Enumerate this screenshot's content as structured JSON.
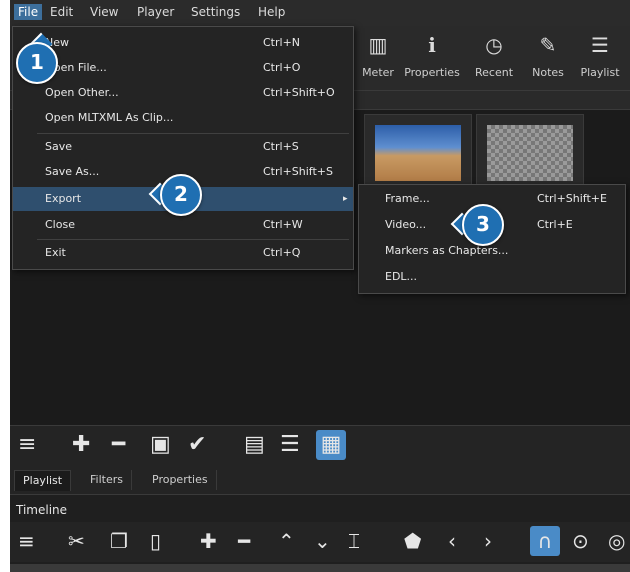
{
  "menubar": {
    "items": [
      "File",
      "Edit",
      "View",
      "Player",
      "Settings",
      "Help"
    ]
  },
  "toolbar": {
    "buttons": [
      {
        "label": "Meter",
        "icon": "meter-icon"
      },
      {
        "label": "Properties",
        "icon": "info-icon"
      },
      {
        "label": "Recent",
        "icon": "clock-icon"
      },
      {
        "label": "Notes",
        "icon": "notes-icon"
      },
      {
        "label": "Playlist",
        "icon": "list-icon"
      }
    ]
  },
  "file_menu": {
    "items": [
      {
        "label": "New",
        "shortcut": "Ctrl+N"
      },
      {
        "label": "Open File...",
        "shortcut": "Ctrl+O"
      },
      {
        "label": "Open Other...",
        "shortcut": "Ctrl+Shift+O"
      },
      {
        "label": "Open MLTXML As Clip...",
        "shortcut": ""
      },
      {
        "label": "Save",
        "shortcut": "Ctrl+S"
      },
      {
        "label": "Save As...",
        "shortcut": "Ctrl+Shift+S"
      },
      {
        "label": "Export",
        "shortcut": ""
      },
      {
        "label": "Close",
        "shortcut": "Ctrl+W"
      },
      {
        "label": "Exit",
        "shortcut": "Ctrl+Q"
      }
    ]
  },
  "export_submenu": {
    "items": [
      {
        "label": "Frame...",
        "shortcut": "Ctrl+Shift+E"
      },
      {
        "label": "Video...",
        "shortcut": "Ctrl+E"
      },
      {
        "label": "Markers as Chapters...",
        "shortcut": ""
      },
      {
        "label": "EDL...",
        "shortcut": ""
      }
    ]
  },
  "bottom_tabs": [
    "Playlist",
    "Filters",
    "Properties"
  ],
  "timeline": {
    "label": "Timeline"
  },
  "steps": [
    "1",
    "2",
    "3"
  ],
  "colors": {
    "accent": "#4a8bc7",
    "badge": "#1f6fb2",
    "highlight": "#2f4f6e"
  }
}
